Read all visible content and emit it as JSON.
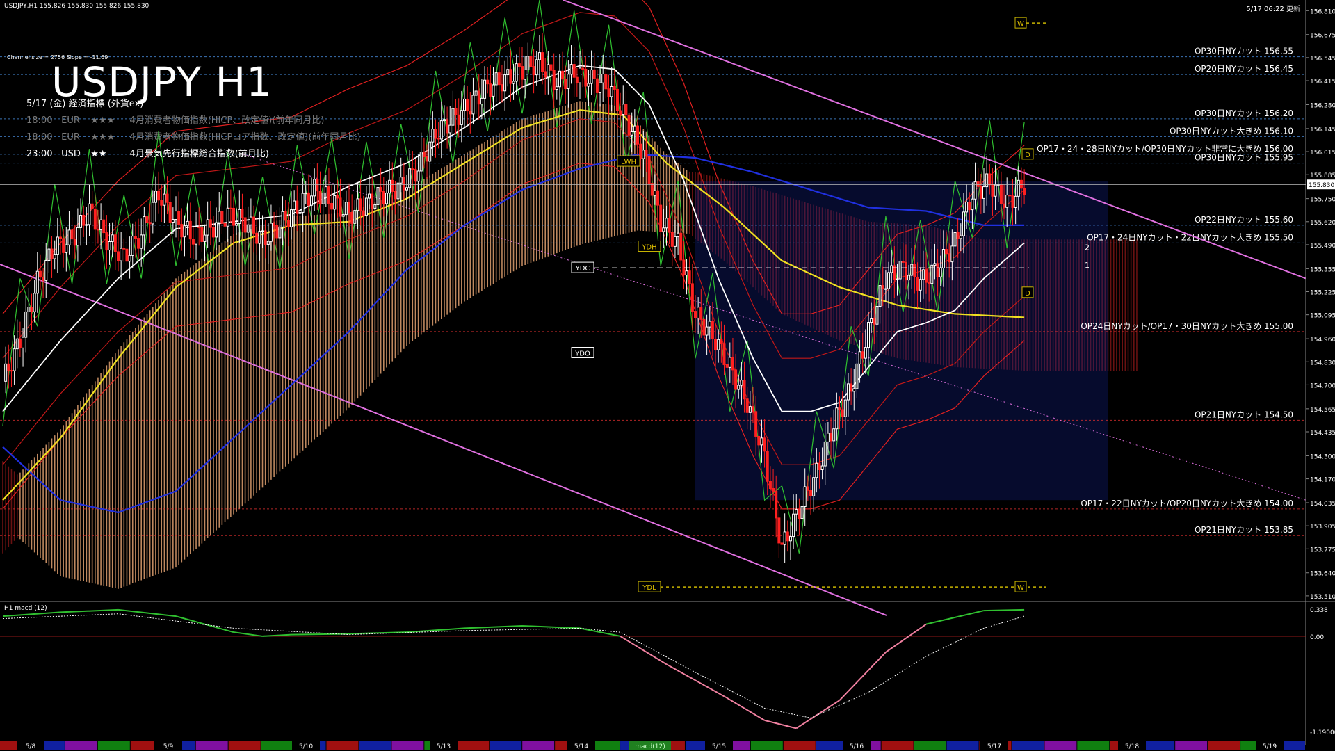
{
  "header": {
    "symbol_info": "USDJPY,H1  155.826 155.830 155.826 155.830",
    "timestamp": "5/17 06:22 更新",
    "channel_info": "Channel size = 2756 Slope = -11.69",
    "big_title": "USDJPY H1"
  },
  "events": {
    "heading": "5/17 (金) 経済指標 (外貨ex)",
    "rows": [
      {
        "time": "18:00",
        "cur": "EUR",
        "stars": "★★★",
        "name": "4月消費者物価指数(HICP、改定値)(前年同月比)",
        "color": "#7a7a7a"
      },
      {
        "time": "18:00",
        "cur": "EUR",
        "stars": "★★★",
        "name": "4月消費者物価指数(HICPコア指数、改定値)(前年同月比)",
        "color": "#7a7a7a"
      },
      {
        "time": "23:00",
        "cur": "USD",
        "stars": "★★",
        "name": "4月景気先行指標総合指数(前月比)",
        "color": "#ffffff"
      }
    ]
  },
  "price_axis": {
    "ticks": [
      "156.810",
      "156.675",
      "156.545",
      "156.415",
      "156.280",
      "156.145",
      "156.015",
      "155.885",
      "155.750",
      "155.620",
      "155.490",
      "155.355",
      "155.225",
      "155.095",
      "154.960",
      "154.830",
      "154.700",
      "154.565",
      "154.435",
      "154.300",
      "154.170",
      "154.035",
      "153.905",
      "153.775",
      "153.640",
      "153.510"
    ],
    "current_price": "155.830",
    "current_price_value": 155.83,
    "top_value": 156.87,
    "bottom_value": 153.49
  },
  "option_cuts": [
    {
      "label": "OP30日NYカット 156.55",
      "price": 156.55,
      "color": "#4a90e2",
      "style": "dash"
    },
    {
      "label": "OP20日NYカット 156.45",
      "price": 156.45,
      "color": "#4a90e2",
      "style": "dash"
    },
    {
      "label": "OP30日NYカット 156.20",
      "price": 156.2,
      "color": "#4a90e2",
      "style": "dash"
    },
    {
      "label": "OP30日NYカット大きめ 156.10",
      "price": 156.1,
      "color": "#4a90e2",
      "style": "dash"
    },
    {
      "label": "OP17・24・28日NYカット/OP30日NYカット非常に大きめ 156.00",
      "price": 156.0,
      "color": "#4a90e2",
      "style": "dash"
    },
    {
      "label": "OP30日NYカット 155.95",
      "price": 155.95,
      "color": "#4a90e2",
      "style": "dash"
    },
    {
      "label": "OP22日NYカット 155.60",
      "price": 155.6,
      "color": "#4a90e2",
      "style": "dash"
    },
    {
      "label": "OP17・24日NYカット・22日NYカット大きめ 155.50",
      "price": 155.5,
      "color": "#4a90e2",
      "style": "dash"
    },
    {
      "label": "OP24日NYカット/OP17・30日NYカット大きめ 155.00",
      "price": 155.0,
      "color": "#e03030",
      "style": "dash"
    },
    {
      "label": "OP21日NYカット 154.50",
      "price": 154.5,
      "color": "#e03030",
      "style": "dash"
    },
    {
      "label": "OP17・22日NYカット/OP20日NYカット大きめ 154.00",
      "price": 154.0,
      "color": "#e03030",
      "style": "dash"
    },
    {
      "label": "OP21日NYカット 153.85",
      "price": 153.85,
      "color": "#e03030",
      "style": "dash"
    }
  ],
  "level_tags": [
    {
      "text": "W",
      "price": 156.74,
      "pos": "w1"
    },
    {
      "text": "LWH",
      "price": 155.96,
      "pos": "lwh"
    },
    {
      "text": "D",
      "price": 156.0,
      "pos": "d1"
    },
    {
      "text": "YDH",
      "price": 155.48,
      "pos": "ydh"
    },
    {
      "text": "YDC",
      "price": 155.36,
      "pos": "ydc"
    },
    {
      "text": "D",
      "price": 155.22,
      "pos": "d2"
    },
    {
      "text": "YDO",
      "price": 154.88,
      "pos": "ydo"
    },
    {
      "text": "YDL",
      "price": 153.56,
      "pos": "ydl"
    },
    {
      "text": "W",
      "price": 153.56,
      "pos": "w2"
    }
  ],
  "projection_labels": [
    "2",
    "1"
  ],
  "x_axis": {
    "labels": [
      "5/8",
      "5/9",
      "5/10",
      "5/13",
      "5/14",
      "5/15",
      "5/16",
      "5/17",
      "5/18",
      "5/19"
    ],
    "indicator_name": "macd(12)"
  },
  "macd": {
    "title": "H1  macd (12)",
    "scale_top": "0.338",
    "scale_zero": "0.00",
    "scale_bottom": "-1.190000"
  },
  "chart_data": {
    "type": "candlestick",
    "title": "USDJPY H1",
    "categories": [
      "5/8",
      "5/9",
      "5/10",
      "5/13",
      "5/14",
      "5/15",
      "5/16",
      "5/17"
    ],
    "price_ylim": [
      153.49,
      156.87
    ],
    "close_path": [
      [
        0,
        154.72
      ],
      [
        6,
        154.95
      ],
      [
        12,
        155.28
      ],
      [
        18,
        155.48
      ],
      [
        24,
        155.52
      ],
      [
        30,
        155.68
      ],
      [
        36,
        155.52
      ],
      [
        42,
        155.42
      ],
      [
        48,
        155.55
      ],
      [
        54,
        155.78
      ],
      [
        60,
        155.62
      ],
      [
        66,
        155.54
      ],
      [
        72,
        155.58
      ],
      [
        78,
        155.66
      ],
      [
        84,
        155.62
      ],
      [
        90,
        155.52
      ],
      [
        96,
        155.6
      ],
      [
        102,
        155.7
      ],
      [
        108,
        155.8
      ],
      [
        114,
        155.74
      ],
      [
        120,
        155.66
      ],
      [
        126,
        155.72
      ],
      [
        132,
        155.78
      ],
      [
        138,
        155.82
      ],
      [
        144,
        155.92
      ],
      [
        150,
        156.12
      ],
      [
        156,
        156.2
      ],
      [
        162,
        156.28
      ],
      [
        168,
        156.38
      ],
      [
        174,
        156.42
      ],
      [
        180,
        156.48
      ],
      [
        186,
        156.52
      ],
      [
        192,
        156.4
      ],
      [
        198,
        156.46
      ],
      [
        204,
        156.42
      ],
      [
        210,
        156.38
      ],
      [
        216,
        156.2
      ],
      [
        222,
        156.0
      ],
      [
        228,
        155.62
      ],
      [
        234,
        155.5
      ],
      [
        240,
        155.1
      ],
      [
        246,
        154.98
      ],
      [
        252,
        154.8
      ],
      [
        258,
        154.6
      ],
      [
        264,
        154.3
      ],
      [
        270,
        153.78
      ],
      [
        276,
        154.0
      ],
      [
        282,
        154.2
      ],
      [
        288,
        154.48
      ],
      [
        294,
        154.68
      ],
      [
        300,
        155.0
      ],
      [
        306,
        155.3
      ],
      [
        312,
        155.36
      ],
      [
        318,
        155.28
      ],
      [
        324,
        155.36
      ],
      [
        330,
        155.5
      ],
      [
        336,
        155.78
      ],
      [
        342,
        155.84
      ],
      [
        348,
        155.72
      ],
      [
        354,
        155.83
      ]
    ],
    "yellow_ma": [
      [
        0,
        154.05
      ],
      [
        20,
        154.4
      ],
      [
        40,
        154.85
      ],
      [
        60,
        155.25
      ],
      [
        80,
        155.5
      ],
      [
        100,
        155.6
      ],
      [
        120,
        155.62
      ],
      [
        140,
        155.75
      ],
      [
        160,
        155.95
      ],
      [
        180,
        156.15
      ],
      [
        200,
        156.25
      ],
      [
        215,
        156.22
      ],
      [
        230,
        155.95
      ],
      [
        250,
        155.7
      ],
      [
        270,
        155.4
      ],
      [
        290,
        155.25
      ],
      [
        310,
        155.15
      ],
      [
        330,
        155.1
      ],
      [
        354,
        155.08
      ]
    ],
    "blue_ma": [
      [
        0,
        154.35
      ],
      [
        20,
        154.05
      ],
      [
        40,
        153.98
      ],
      [
        60,
        154.1
      ],
      [
        80,
        154.4
      ],
      [
        100,
        154.7
      ],
      [
        120,
        155.0
      ],
      [
        140,
        155.35
      ],
      [
        160,
        155.6
      ],
      [
        180,
        155.8
      ],
      [
        200,
        155.92
      ],
      [
        220,
        156.0
      ],
      [
        240,
        155.98
      ],
      [
        260,
        155.9
      ],
      [
        280,
        155.8
      ],
      [
        300,
        155.7
      ],
      [
        320,
        155.68
      ],
      [
        340,
        155.6
      ],
      [
        354,
        155.6
      ]
    ],
    "white_ma": [
      [
        0,
        154.55
      ],
      [
        20,
        154.95
      ],
      [
        40,
        155.3
      ],
      [
        60,
        155.58
      ],
      [
        80,
        155.62
      ],
      [
        100,
        155.66
      ],
      [
        120,
        155.82
      ],
      [
        140,
        155.95
      ],
      [
        160,
        156.15
      ],
      [
        180,
        156.38
      ],
      [
        200,
        156.5
      ],
      [
        212,
        156.48
      ],
      [
        224,
        156.28
      ],
      [
        236,
        155.85
      ],
      [
        248,
        155.3
      ],
      [
        260,
        154.85
      ],
      [
        270,
        154.55
      ],
      [
        280,
        154.55
      ],
      [
        290,
        154.6
      ],
      [
        300,
        154.8
      ],
      [
        310,
        155.0
      ],
      [
        320,
        155.05
      ],
      [
        330,
        155.12
      ],
      [
        340,
        155.3
      ],
      [
        354,
        155.5
      ]
    ],
    "macd_main": [
      [
        0,
        0.25
      ],
      [
        20,
        0.3
      ],
      [
        40,
        0.33
      ],
      [
        60,
        0.25
      ],
      [
        80,
        0.05
      ],
      [
        90,
        0.0
      ],
      [
        100,
        0.02
      ],
      [
        120,
        0.03
      ],
      [
        140,
        0.05
      ],
      [
        160,
        0.1
      ],
      [
        180,
        0.13
      ],
      [
        200,
        0.1
      ],
      [
        214,
        0.0
      ],
      [
        230,
        -0.35
      ],
      [
        250,
        -0.75
      ],
      [
        264,
        -1.05
      ],
      [
        275,
        -1.15
      ],
      [
        290,
        -0.8
      ],
      [
        306,
        -0.2
      ],
      [
        320,
        0.15
      ],
      [
        340,
        0.32
      ],
      [
        354,
        0.33
      ]
    ],
    "macd_signal": [
      [
        0,
        0.22
      ],
      [
        40,
        0.28
      ],
      [
        80,
        0.1
      ],
      [
        120,
        0.02
      ],
      [
        160,
        0.07
      ],
      [
        200,
        0.1
      ],
      [
        214,
        0.05
      ],
      [
        240,
        -0.45
      ],
      [
        264,
        -0.9
      ],
      [
        280,
        -1.02
      ],
      [
        300,
        -0.7
      ],
      [
        320,
        -0.25
      ],
      [
        340,
        0.1
      ],
      [
        354,
        0.25
      ]
    ]
  },
  "colors": {
    "bull": "#ffffff",
    "bear": "#ff2020",
    "cloud_bull": "#e0a070",
    "cloud_bear": "#c02020",
    "yellow_ma": "#f0e020",
    "blue_ma": "#2030e0",
    "green_line": "#30c030",
    "pink_channel": "#e070e0",
    "macd_main": "#30c030",
    "macd_signal": "#ffffff"
  }
}
